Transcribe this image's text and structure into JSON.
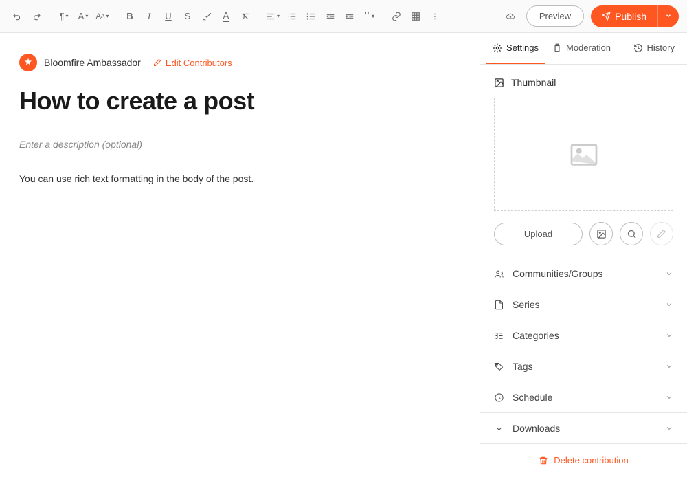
{
  "toolbar": {
    "preview_label": "Preview",
    "publish_label": "Publish"
  },
  "editor": {
    "author_name": "Bloomfire Ambassador",
    "edit_contributors_label": "Edit Contributors",
    "title": "How to create a post",
    "description_placeholder": "Enter a description (optional)",
    "body": "You can use rich text formatting in the body of the post."
  },
  "sidebar": {
    "tabs": {
      "settings": "Settings",
      "moderation": "Moderation",
      "history": "History"
    },
    "thumbnail": {
      "label": "Thumbnail",
      "upload_label": "Upload"
    },
    "sections": {
      "communities": "Communities/Groups",
      "series": "Series",
      "categories": "Categories",
      "tags": "Tags",
      "schedule": "Schedule",
      "downloads": "Downloads"
    },
    "delete_label": "Delete contribution"
  }
}
